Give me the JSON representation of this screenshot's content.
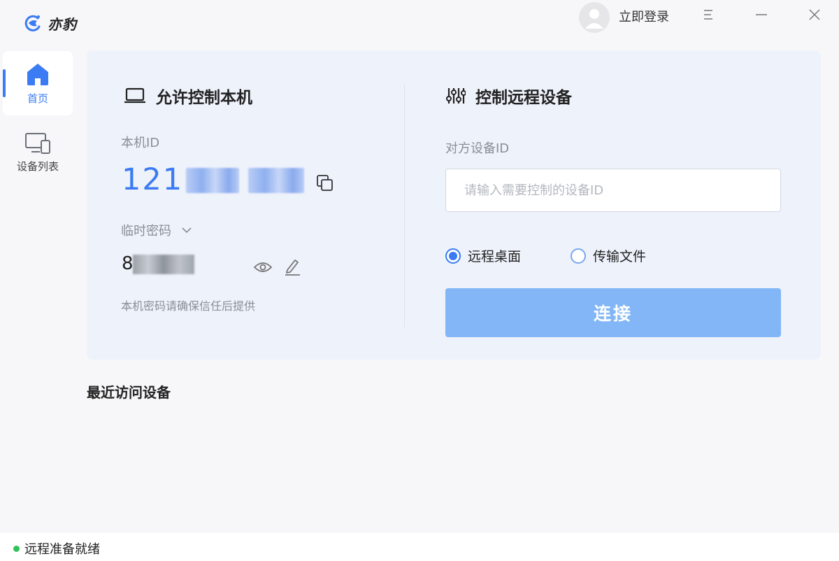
{
  "app": {
    "name": "亦豹"
  },
  "header": {
    "login_label": "立即登录"
  },
  "sidebar": {
    "items": [
      {
        "label": "首页",
        "icon": "home-icon",
        "active": true
      },
      {
        "label": "设备列表",
        "icon": "devices-icon",
        "active": false
      }
    ]
  },
  "local": {
    "title": "允许控制本机",
    "id_label": "本机ID",
    "id_value": "121",
    "password_label": "临时密码",
    "password_value": "8",
    "hint": "本机密码请确保信任后提供"
  },
  "remote": {
    "title": "控制远程设备",
    "peer_label": "对方设备ID",
    "input_placeholder": "请输入需要控制的设备ID",
    "input_value": "",
    "mode_options": [
      "远程桌面",
      "传输文件"
    ],
    "selected_mode": "远程桌面",
    "connect_label": "连接"
  },
  "recent": {
    "title": "最近访问设备"
  },
  "status": {
    "text": "远程准备就绪",
    "color": "#2fc25b"
  },
  "colors": {
    "accent": "#3b7bf3",
    "connect_button": "#82b6f6",
    "card_background": "#eef2fb"
  }
}
